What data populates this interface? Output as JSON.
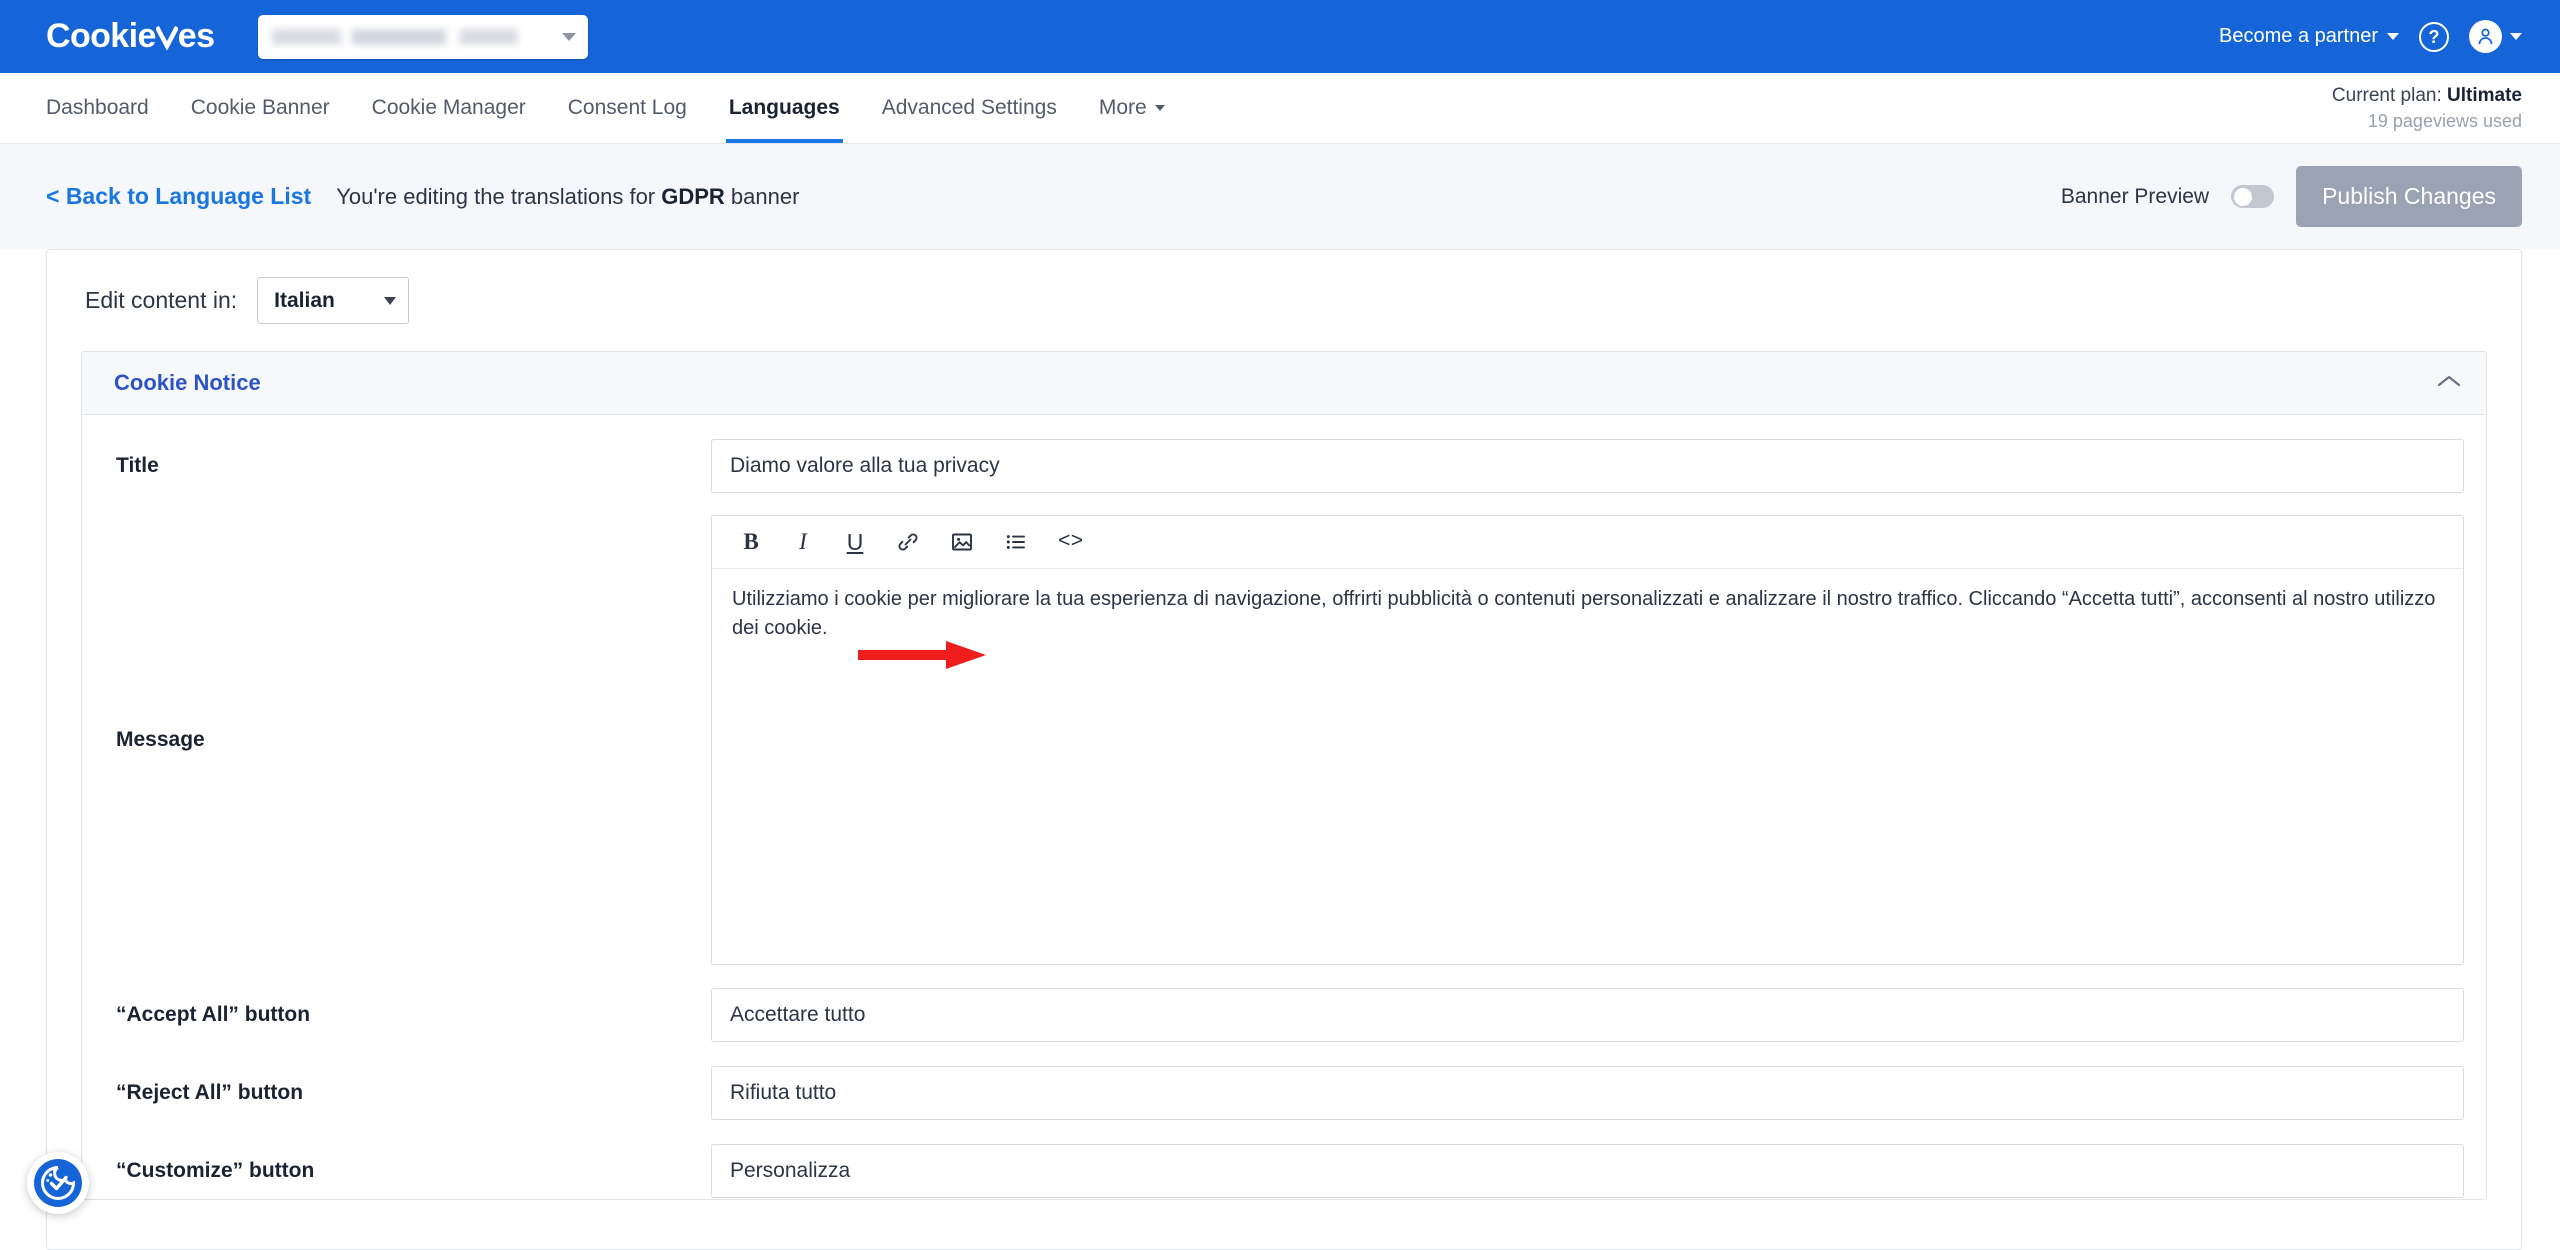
{
  "topbar": {
    "logo_text_1": "Cookie",
    "logo_text_2": "es",
    "site_selector_value": "",
    "partner_label": "Become a partner",
    "help_label": "?",
    "brand_color": "#1565d8"
  },
  "nav": {
    "items": [
      {
        "label": "Dashboard",
        "active": false
      },
      {
        "label": "Cookie Banner",
        "active": false
      },
      {
        "label": "Cookie Manager",
        "active": false
      },
      {
        "label": "Consent Log",
        "active": false
      },
      {
        "label": "Languages",
        "active": true
      },
      {
        "label": "Advanced Settings",
        "active": false
      },
      {
        "label": "More",
        "active": false,
        "has_caret": true
      }
    ],
    "plan_prefix": "Current plan: ",
    "plan_name": "Ultimate",
    "pageviews": "19 pageviews used",
    "active_underline_color": "#1877e3"
  },
  "subheader": {
    "back_link": "< Back to Language List",
    "editing_prefix": "You're editing the translations for ",
    "banner_name": "GDPR",
    "editing_suffix": " banner",
    "banner_preview_label": "Banner Preview",
    "banner_preview_on": false,
    "publish_label": "Publish Changes",
    "publish_disabled": true
  },
  "main": {
    "edit_content_label": "Edit content in:",
    "language_value": "Italian",
    "accordion": {
      "title": "Cookie Notice",
      "expanded": true
    },
    "fields": [
      {
        "label": "Title",
        "type": "input",
        "value": "Diamo valore alla tua privacy"
      },
      {
        "label": "Message",
        "type": "richtext",
        "value": "Utilizziamo i cookie per migliorare la tua esperienza di navigazione, offrirti pubblicità o contenuti personalizzati e analizzare il nostro traffico. Cliccando “Accetta tutti”, acconsenti al nostro utilizzo dei cookie."
      },
      {
        "label": "“Accept All” button",
        "type": "input",
        "value": "Accettare tutto"
      },
      {
        "label": "“Reject All” button",
        "type": "input",
        "value": "Rifiuta tutto"
      },
      {
        "label": "“Customize” button",
        "type": "input",
        "value": "Personalizza"
      }
    ],
    "editor_toolbar": [
      {
        "name": "bold-icon",
        "glyph": "B"
      },
      {
        "name": "italic-icon",
        "glyph": "I"
      },
      {
        "name": "underline-icon",
        "glyph": "U"
      },
      {
        "name": "link-icon",
        "glyph": "🔗"
      },
      {
        "name": "image-icon",
        "glyph": "🖼"
      },
      {
        "name": "bullet-list-icon",
        "glyph": "☰"
      },
      {
        "name": "code-icon",
        "glyph": "<>"
      }
    ]
  },
  "annotations": {
    "arrow_color": "#f01d1d",
    "arrow_preview_target": "Banner Preview",
    "arrow_message_target": "Message"
  },
  "cookie_badge": {
    "icon": "cookie-consent-icon",
    "color": "#1565d8"
  }
}
